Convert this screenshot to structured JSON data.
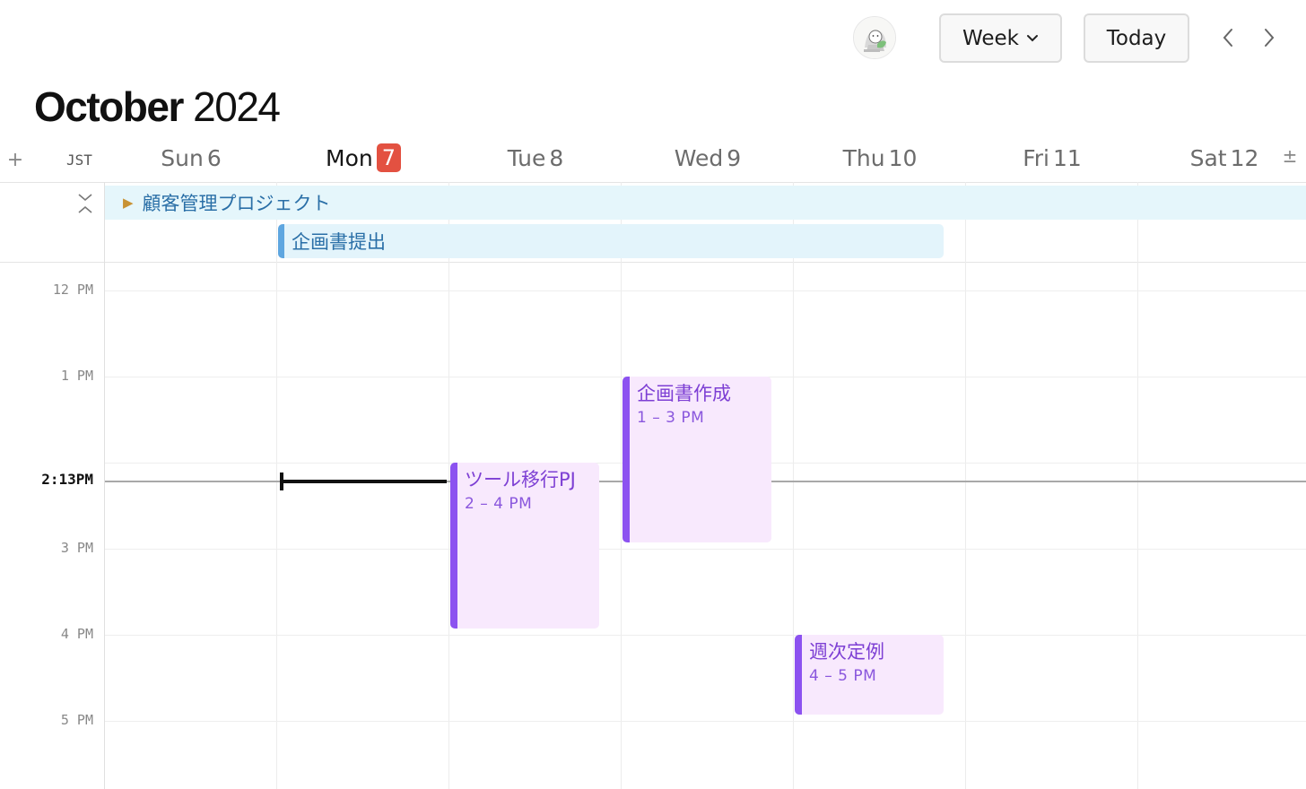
{
  "toolbar": {
    "avatar_icon": "user-avatar-illustration",
    "view_label": "Week",
    "today_label": "Today",
    "prev_icon": "chevron-left-icon",
    "next_icon": "chevron-right-icon"
  },
  "title": {
    "month": "October",
    "year": "2024"
  },
  "header": {
    "timezone": "JST",
    "days": [
      {
        "name": "Sun",
        "num": "6"
      },
      {
        "name": "Mon",
        "num": "7",
        "today": true
      },
      {
        "name": "Tue",
        "num": "8"
      },
      {
        "name": "Wed",
        "num": "9"
      },
      {
        "name": "Thu",
        "num": "10"
      },
      {
        "name": "Fri",
        "num": "11"
      },
      {
        "name": "Sat",
        "num": "12"
      }
    ]
  },
  "all_day": {
    "project": {
      "label": "顧客管理プロジェクト",
      "expanded_icon": "triangle-right-icon"
    },
    "events": [
      {
        "title": "企画書提出",
        "color": "#5ea6e0"
      }
    ]
  },
  "time_labels": [
    "12 PM",
    "1 PM",
    "3 PM",
    "4 PM",
    "5 PM"
  ],
  "now": {
    "label": "2:13PM"
  },
  "events": [
    {
      "title": "企画書作成",
      "time": "1 – 3 PM"
    },
    {
      "title": "ツール移行PJ",
      "time": "2 – 4 PM"
    },
    {
      "title": "週次定例",
      "time": "4 – 5 PM"
    }
  ],
  "colors": {
    "accent_today": "#e35141",
    "event_purple": "#8c52f0",
    "event_bg": "#f8e9fd",
    "allday_bg": "#e5f6fb"
  }
}
